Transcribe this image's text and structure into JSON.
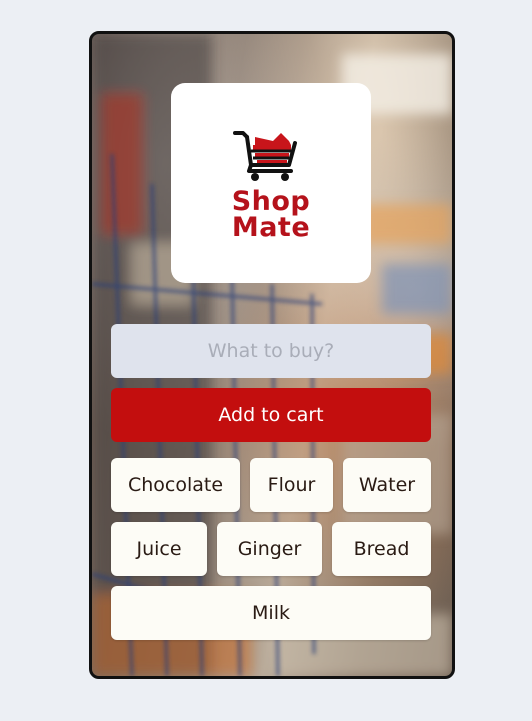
{
  "app": {
    "brand_line1": "Shop",
    "brand_line2": "Mate",
    "brand_color": "#b5121b"
  },
  "search": {
    "placeholder": "What to buy?",
    "value": ""
  },
  "add_button": {
    "label": "Add to cart",
    "color": "#c30e0e"
  },
  "items": [
    {
      "label": "Chocolate"
    },
    {
      "label": "Flour"
    },
    {
      "label": "Water"
    },
    {
      "label": "Juice"
    },
    {
      "label": "Ginger"
    },
    {
      "label": "Bread"
    },
    {
      "label": "Milk"
    }
  ],
  "icons": {
    "logo": "shopping-cart-icon"
  }
}
